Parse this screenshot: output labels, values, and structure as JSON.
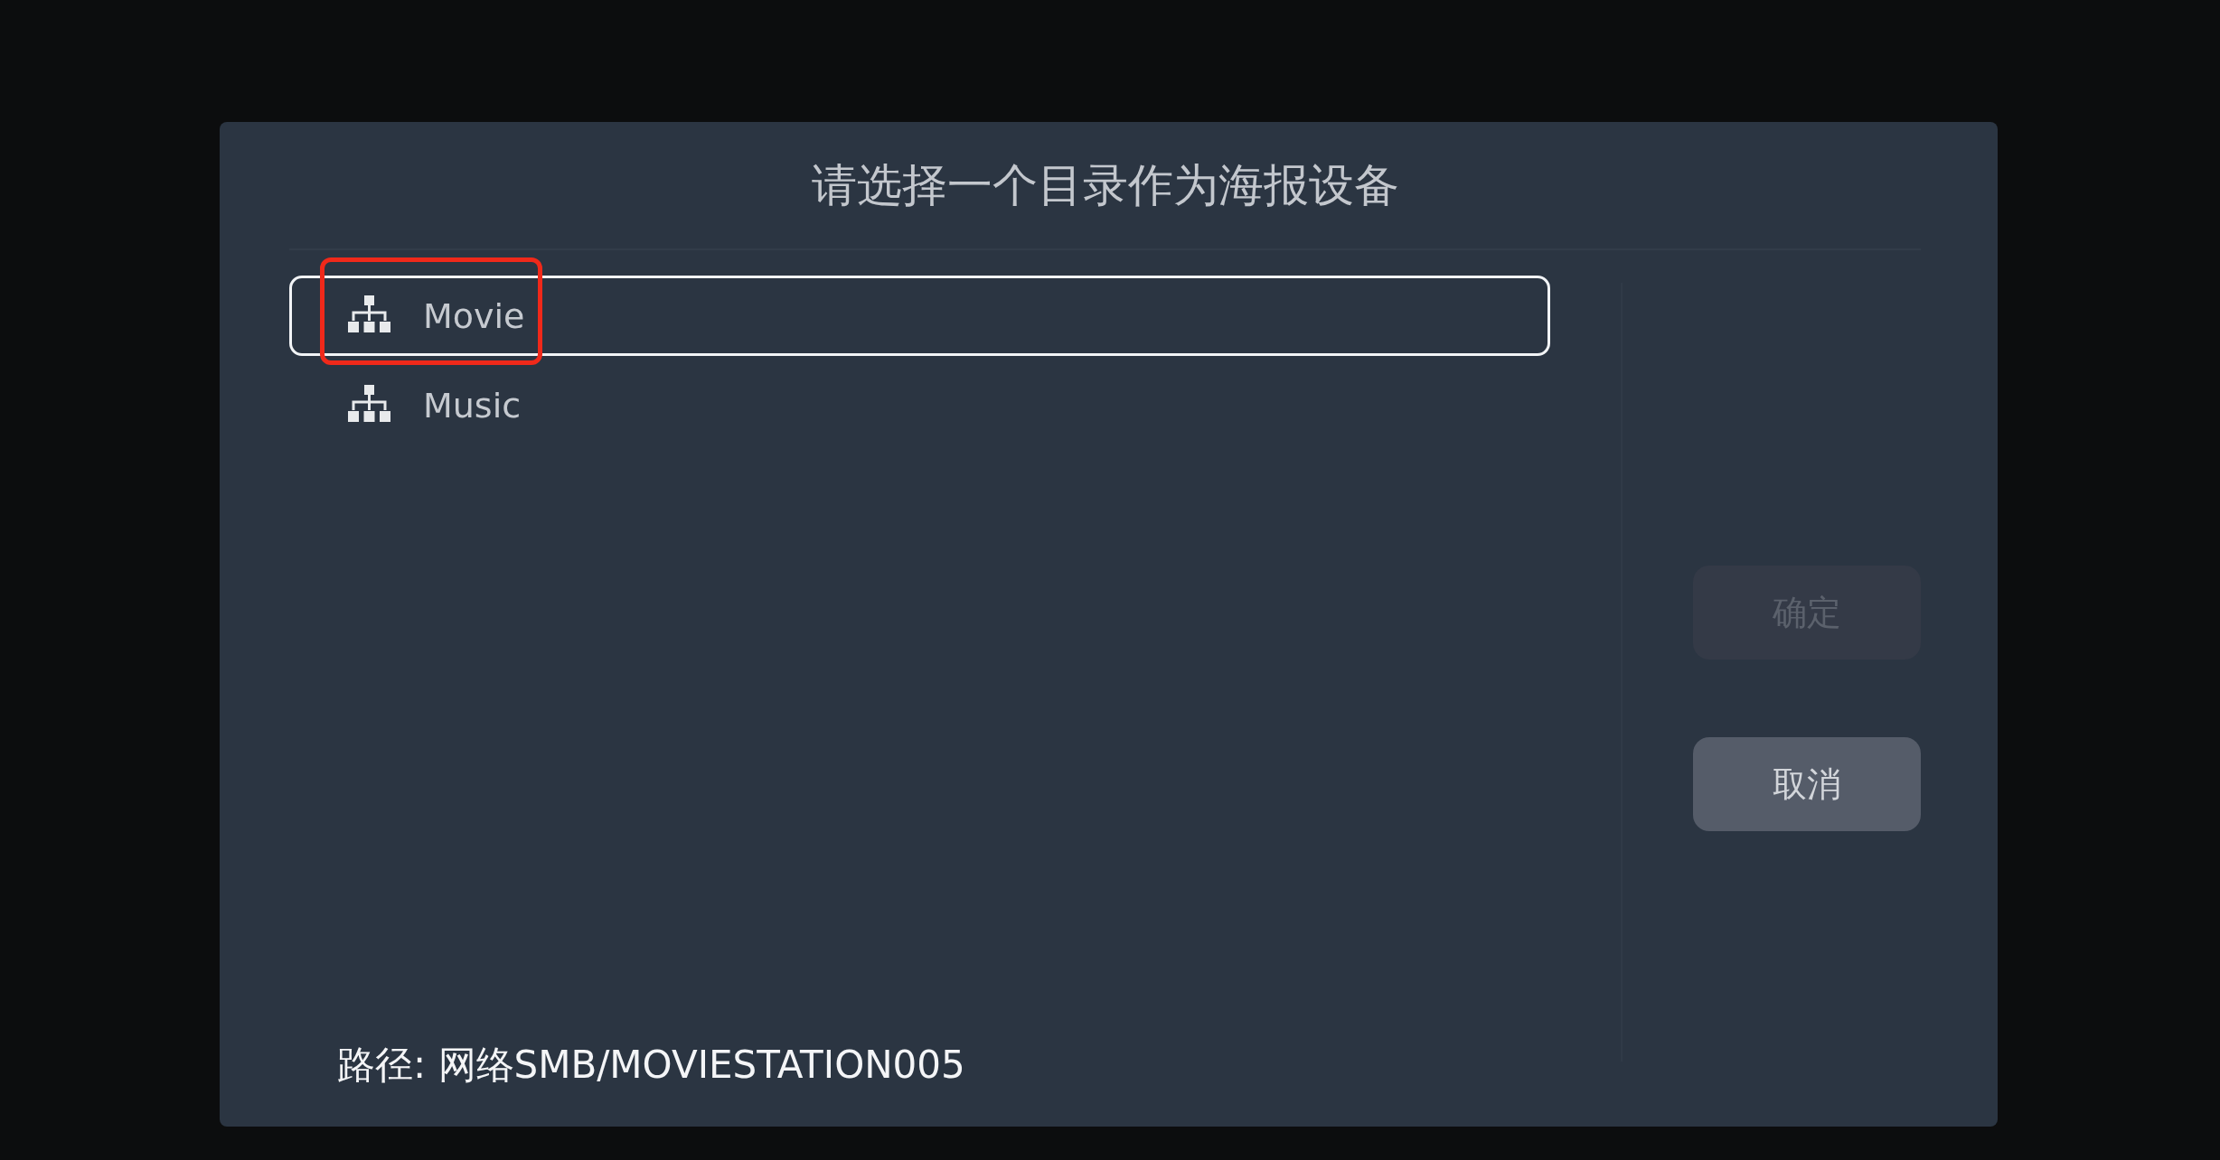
{
  "dialog": {
    "title": "请选择一个目录作为海报设备",
    "folders": [
      {
        "label": "Movie",
        "selected": true,
        "highlighted": true
      },
      {
        "label": "Music",
        "selected": false,
        "highlighted": false
      }
    ],
    "path": "路径: 网络SMB/MOVIESTATION005",
    "buttons": [
      {
        "label": "确定",
        "disabled": true
      },
      {
        "label": "取消",
        "disabled": false
      }
    ]
  }
}
